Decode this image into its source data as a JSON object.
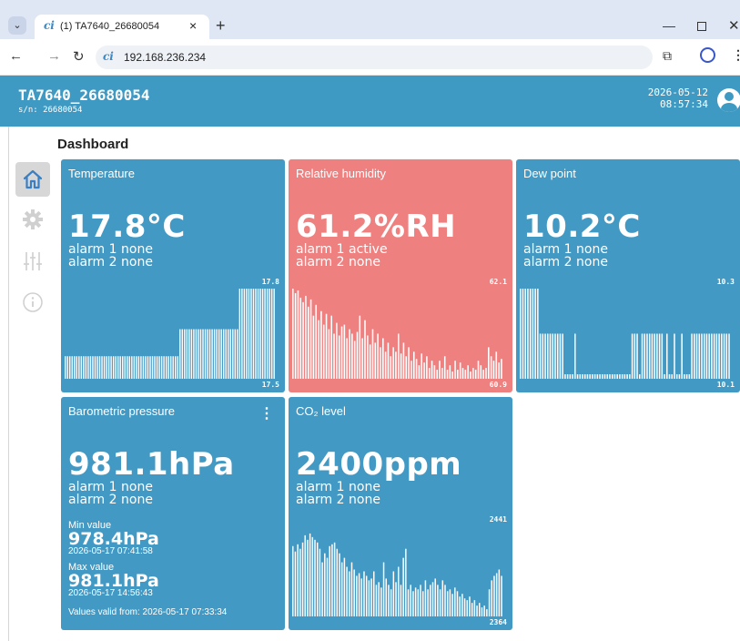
{
  "browser": {
    "tab_title": "(1) TA7640_26680054",
    "favicon": "ci",
    "url": "192.168.236.234"
  },
  "header": {
    "device_name": "TA7640_26680054",
    "serial": "s/n: 26680054",
    "date": "2026-05-12",
    "time": "08:57:34"
  },
  "page_title": "Dashboard",
  "sidebar": {
    "items": [
      {
        "name": "home-icon",
        "active": true
      },
      {
        "name": "gear-icon",
        "active": false
      },
      {
        "name": "sliders-icon",
        "active": false
      },
      {
        "name": "info-icon",
        "active": false
      }
    ]
  },
  "colors": {
    "card_normal": "#4299c4",
    "card_alarm": "#ef8080",
    "header": "#3f9ac3"
  },
  "cards": [
    {
      "title": "Temperature",
      "value": "17.8°C",
      "alarm1": "alarm 1 none",
      "alarm2": "alarm 2 none",
      "chart_max": "17.8",
      "chart_min": "17.5",
      "alarm": false,
      "history": [
        0.25,
        0.25,
        0.25,
        0.25,
        0.25,
        0.25,
        0.25,
        0.25,
        0.25,
        0.25,
        0.25,
        0.25,
        0.25,
        0.25,
        0.25,
        0.25,
        0.25,
        0.25,
        0.25,
        0.25,
        0.25,
        0.25,
        0.25,
        0.25,
        0.25,
        0.25,
        0.25,
        0.25,
        0.25,
        0.25,
        0.25,
        0.25,
        0.25,
        0.25,
        0.25,
        0.25,
        0.25,
        0.25,
        0.25,
        0.25,
        0.25,
        0.25,
        0.25,
        0.25,
        0.25,
        0.25,
        0.25,
        0.25,
        0.25,
        0.25,
        0.55,
        0.55,
        0.55,
        0.55,
        0.55,
        0.55,
        0.55,
        0.55,
        0.55,
        0.55,
        0.55,
        0.55,
        0.55,
        0.55,
        0.55,
        0.55,
        0.55,
        0.55,
        0.55,
        0.55,
        0.55,
        0.55,
        0.55,
        0.55,
        0.55,
        0.55,
        1,
        1,
        1,
        1,
        1,
        1,
        1,
        1,
        1,
        1,
        1,
        1,
        1,
        1,
        1,
        1
      ]
    },
    {
      "title": "Relative humidity",
      "value": "61.2%RH",
      "alarm1": "alarm 1 active",
      "alarm2": "alarm 2 none",
      "chart_max": "62.1",
      "chart_min": "60.9",
      "alarm": true,
      "history": [
        1,
        0.95,
        0.98,
        0.9,
        0.85,
        0.92,
        0.8,
        0.88,
        0.7,
        0.82,
        0.65,
        0.75,
        0.6,
        0.72,
        0.55,
        0.7,
        0.5,
        0.62,
        0.48,
        0.58,
        0.6,
        0.45,
        0.55,
        0.5,
        0.42,
        0.52,
        0.7,
        0.45,
        0.65,
        0.48,
        0.38,
        0.55,
        0.4,
        0.5,
        0.35,
        0.45,
        0.3,
        0.4,
        0.25,
        0.35,
        0.3,
        0.5,
        0.28,
        0.4,
        0.25,
        0.35,
        0.2,
        0.3,
        0.22,
        0.15,
        0.28,
        0.18,
        0.25,
        0.12,
        0.2,
        0.15,
        0.1,
        0.2,
        0.12,
        0.25,
        0.1,
        0.15,
        0.08,
        0.2,
        0.1,
        0.18,
        0.12,
        0.1,
        0.15,
        0.08,
        0.12,
        0.1,
        0.2,
        0.15,
        0.1,
        0.12,
        0.35,
        0.25,
        0.2,
        0.3,
        0.18,
        0.22
      ]
    },
    {
      "title": "Dew point",
      "value": "10.2°C",
      "alarm1": "alarm 1 none",
      "alarm2": "alarm 2 none",
      "chart_max": "10.3",
      "chart_min": "10.1",
      "alarm": false,
      "history": [
        1,
        1,
        1,
        1,
        1,
        1,
        1,
        1,
        0.5,
        0.5,
        0.5,
        0.5,
        0.5,
        0.5,
        0.5,
        0.5,
        0.5,
        0.5,
        0.05,
        0.05,
        0.05,
        0.05,
        0.5,
        0.05,
        0.05,
        0.05,
        0.05,
        0.05,
        0.05,
        0.05,
        0.05,
        0.05,
        0.05,
        0.05,
        0.05,
        0.05,
        0.05,
        0.05,
        0.05,
        0.05,
        0.05,
        0.05,
        0.05,
        0.05,
        0.05,
        0.5,
        0.5,
        0.5,
        0.05,
        0.5,
        0.5,
        0.5,
        0.5,
        0.5,
        0.5,
        0.5,
        0.5,
        0.5,
        0.05,
        0.5,
        0.05,
        0.05,
        0.5,
        0.05,
        0.05,
        0.5,
        0.05,
        0.05,
        0.05,
        0.5,
        0.5,
        0.5,
        0.5,
        0.5,
        0.5,
        0.5,
        0.5,
        0.5,
        0.5,
        0.5,
        0.5,
        0.5,
        0.5,
        0.5,
        0.5
      ]
    },
    {
      "title": "Barometric pressure",
      "value": "981.1hPa",
      "alarm1": "alarm 1 none",
      "alarm2": "alarm 2 none",
      "min_label": "Min value",
      "min_value": "978.4hPa",
      "min_date": "2026-05-17 07:41:58",
      "max_label": "Max value",
      "max_value": "981.1hPa",
      "max_date": "2026-05-17 14:56:43",
      "valid_from": "Values valid from: 2026-05-17 07:33:34",
      "alarm": false
    },
    {
      "title": "CO₂ level",
      "value": "2400ppm",
      "alarm1": "alarm 1 none",
      "alarm2": "alarm 2 none",
      "chart_max": "2441",
      "chart_min": "2364",
      "alarm": false,
      "history": [
        0.78,
        0.72,
        0.8,
        0.75,
        0.82,
        0.9,
        0.85,
        0.92,
        0.88,
        0.85,
        0.82,
        0.75,
        0.6,
        0.7,
        0.65,
        0.78,
        0.8,
        0.82,
        0.75,
        0.7,
        0.6,
        0.65,
        0.55,
        0.5,
        0.6,
        0.52,
        0.45,
        0.48,
        0.42,
        0.5,
        0.45,
        0.4,
        0.42,
        0.5,
        0.35,
        0.38,
        0.32,
        0.6,
        0.42,
        0.35,
        0.3,
        0.5,
        0.38,
        0.55,
        0.35,
        0.65,
        0.75,
        0.3,
        0.35,
        0.28,
        0.32,
        0.3,
        0.35,
        0.28,
        0.4,
        0.3,
        0.35,
        0.38,
        0.42,
        0.35,
        0.3,
        0.4,
        0.35,
        0.28,
        0.3,
        0.25,
        0.32,
        0.28,
        0.22,
        0.25,
        0.2,
        0.18,
        0.22,
        0.15,
        0.18,
        0.12,
        0.15,
        0.1,
        0.12,
        0.08,
        0.3,
        0.4,
        0.45,
        0.48,
        0.52,
        0.45
      ]
    }
  ]
}
